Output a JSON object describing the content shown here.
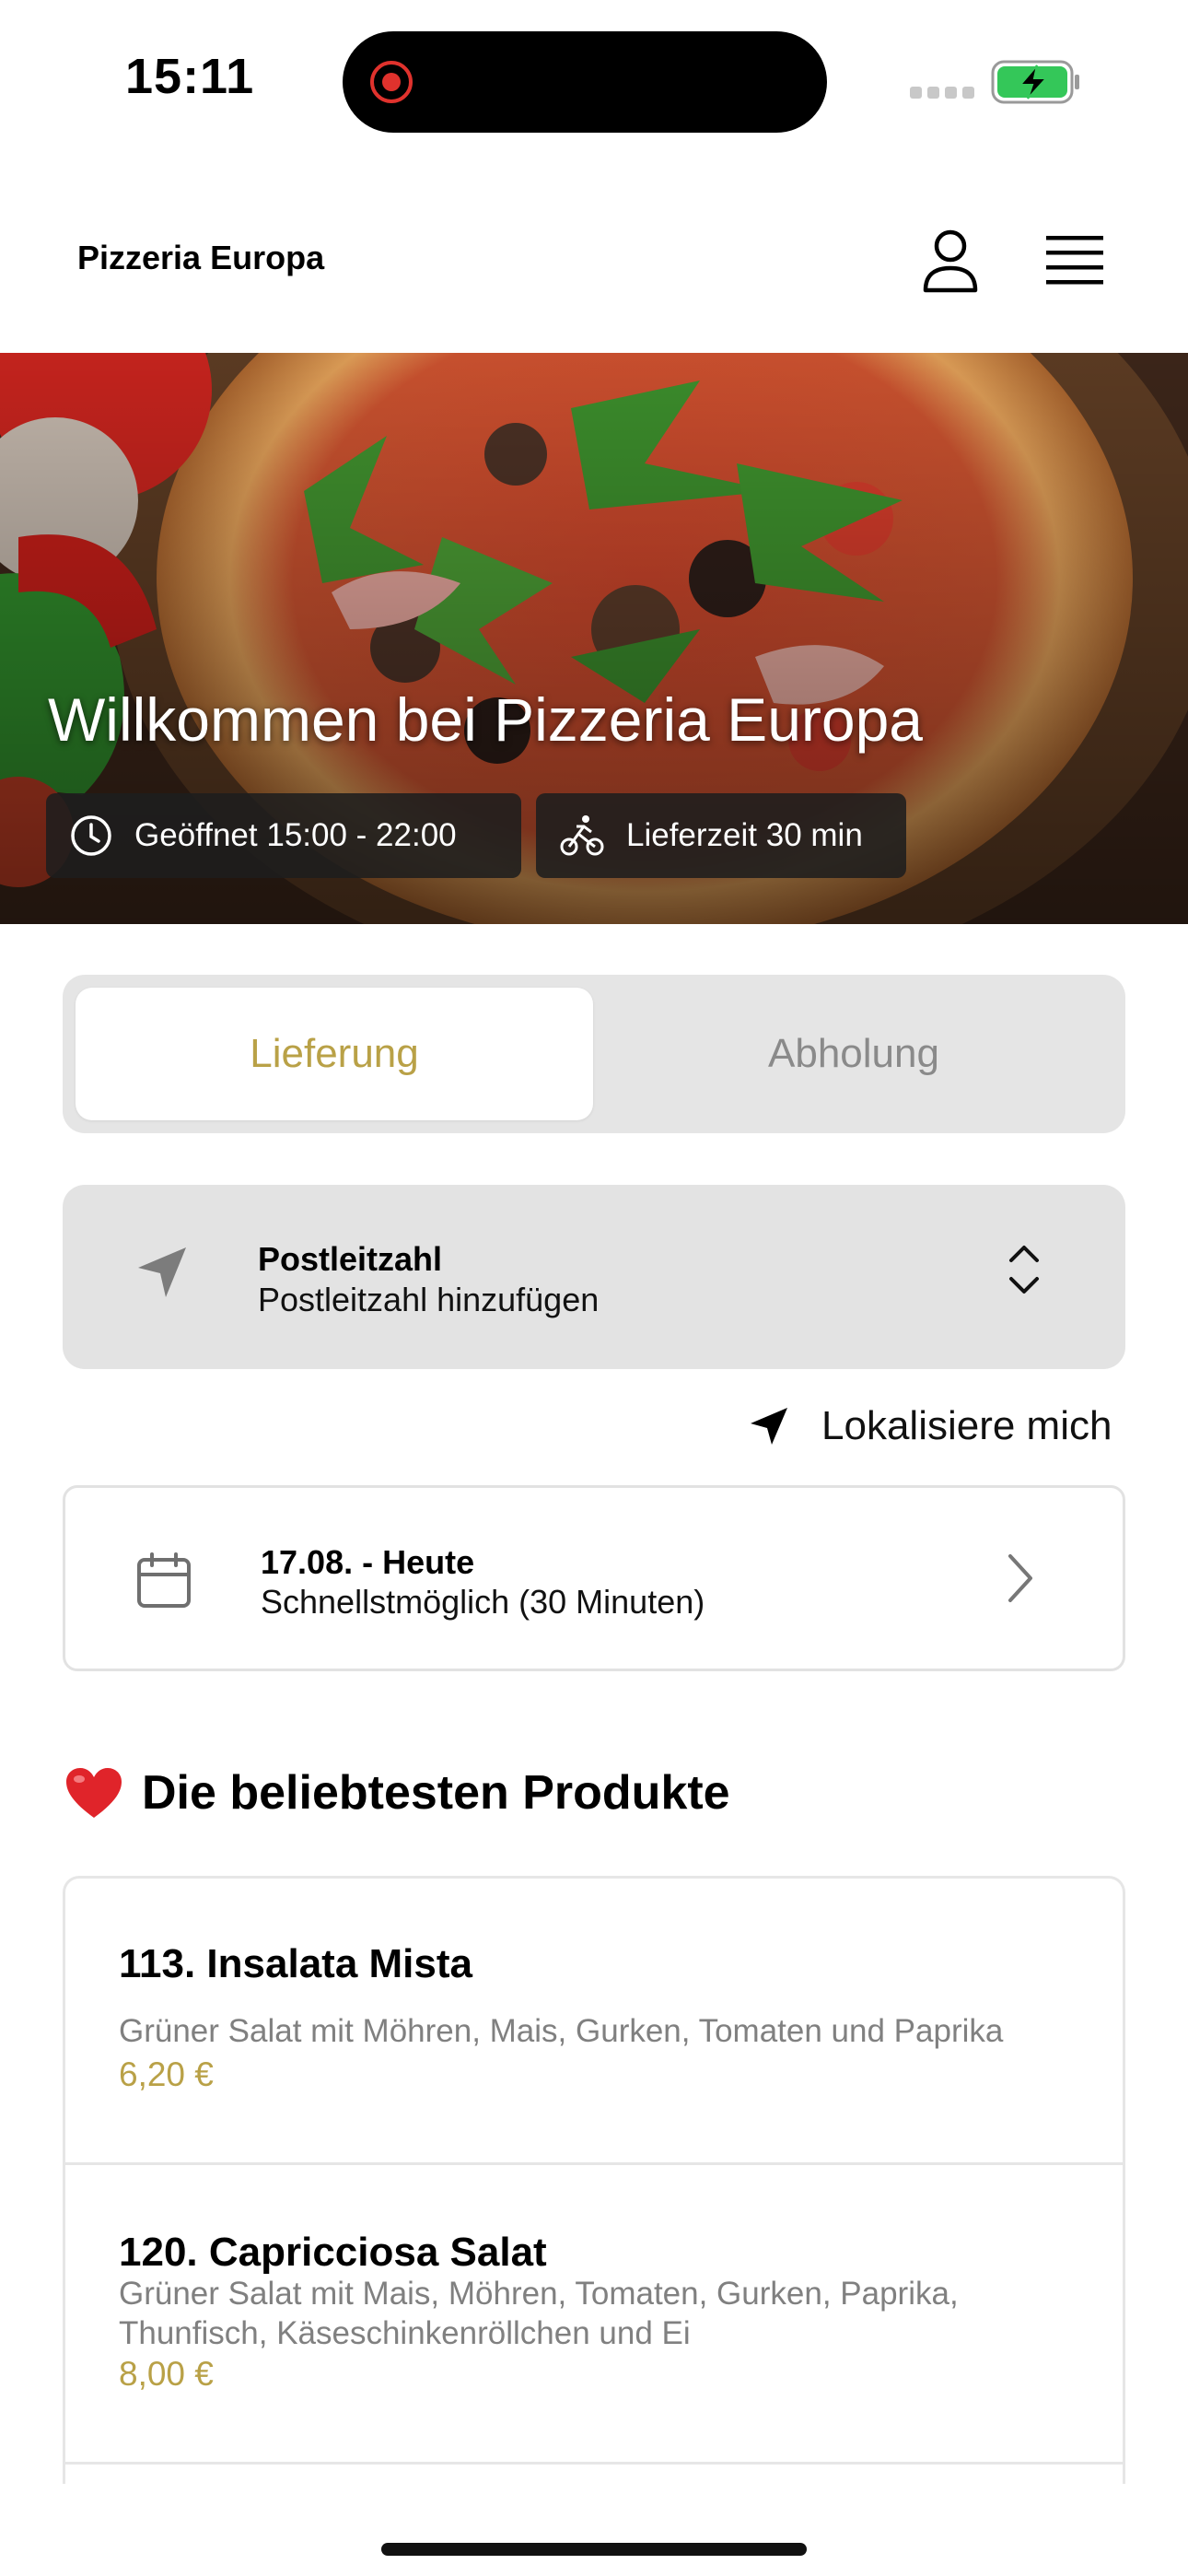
{
  "status_bar": {
    "time": "15:11"
  },
  "header": {
    "title": "Pizzeria Europa"
  },
  "hero": {
    "title": "Willkommen bei Pizzeria Europa",
    "hours": "Geöffnet 15:00 - 22:00",
    "delivery_time": "Lieferzeit 30 min"
  },
  "order_mode": {
    "options": [
      "Lieferung",
      "Abholung"
    ],
    "selected": "Lieferung"
  },
  "postal_code": {
    "label": "Postleitzahl",
    "placeholder": "Postleitzahl hinzufügen"
  },
  "locate_label": "Lokalisiere mich",
  "schedule": {
    "date": "17.08. - Heute",
    "time": "Schnellstmöglich (30 Minuten)"
  },
  "popular": {
    "title": "Die beliebtesten Produkte",
    "products": [
      {
        "name": "113. Insalata Mista",
        "description": "Grüner Salat mit Möhren, Mais, Gurken, Tomaten und Paprika",
        "price": "6,20 €"
      },
      {
        "name": "120. Capricciosa Salat",
        "description": "Grüner Salat mit Mais, Möhren, Tomaten, Gurken, Paprika, Thunfisch, Käseschinkenröllchen und Ei",
        "price": "8,00 €"
      }
    ]
  },
  "colors": {
    "accent": "#b9a147",
    "battery": "#34c759",
    "recording": "#e0322d"
  }
}
